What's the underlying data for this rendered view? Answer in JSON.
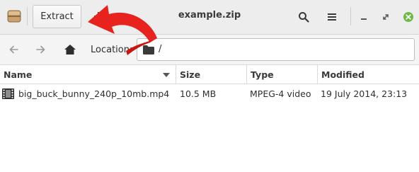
{
  "window": {
    "title": "example.zip"
  },
  "toolbar": {
    "app_icon": "archive-manager-icon",
    "extract_label": "Extract",
    "add_icon": "add-files-icon",
    "search_icon": "search-icon",
    "menu_icon": "hamburger-menu-icon",
    "minimize_icon": "minimize-icon",
    "maximize_icon": "maximize-icon",
    "close_icon": "close-icon"
  },
  "location_bar": {
    "back_icon": "back-arrow-icon",
    "forward_icon": "forward-arrow-icon",
    "home_icon": "home-icon",
    "label": "Location:",
    "path": "/",
    "folder_icon": "folder-icon"
  },
  "file_list": {
    "columns": [
      "Name",
      "Size",
      "Type",
      "Modified"
    ],
    "sort_column": "Name",
    "rows": [
      {
        "icon": "video-file-icon",
        "name": "big_buck_bunny_240p_10mb.mp4",
        "size": "10.5 MB",
        "type": "MPEG-4 video",
        "modified": "19 July 2014, 23:13"
      }
    ]
  },
  "annotation": {
    "type": "curved-arrow",
    "color": "#e8231f",
    "points_to": "extract-button"
  },
  "colors": {
    "close_button": "#6fb843",
    "header_background": "#ededed",
    "arrow": "#e8231f"
  }
}
